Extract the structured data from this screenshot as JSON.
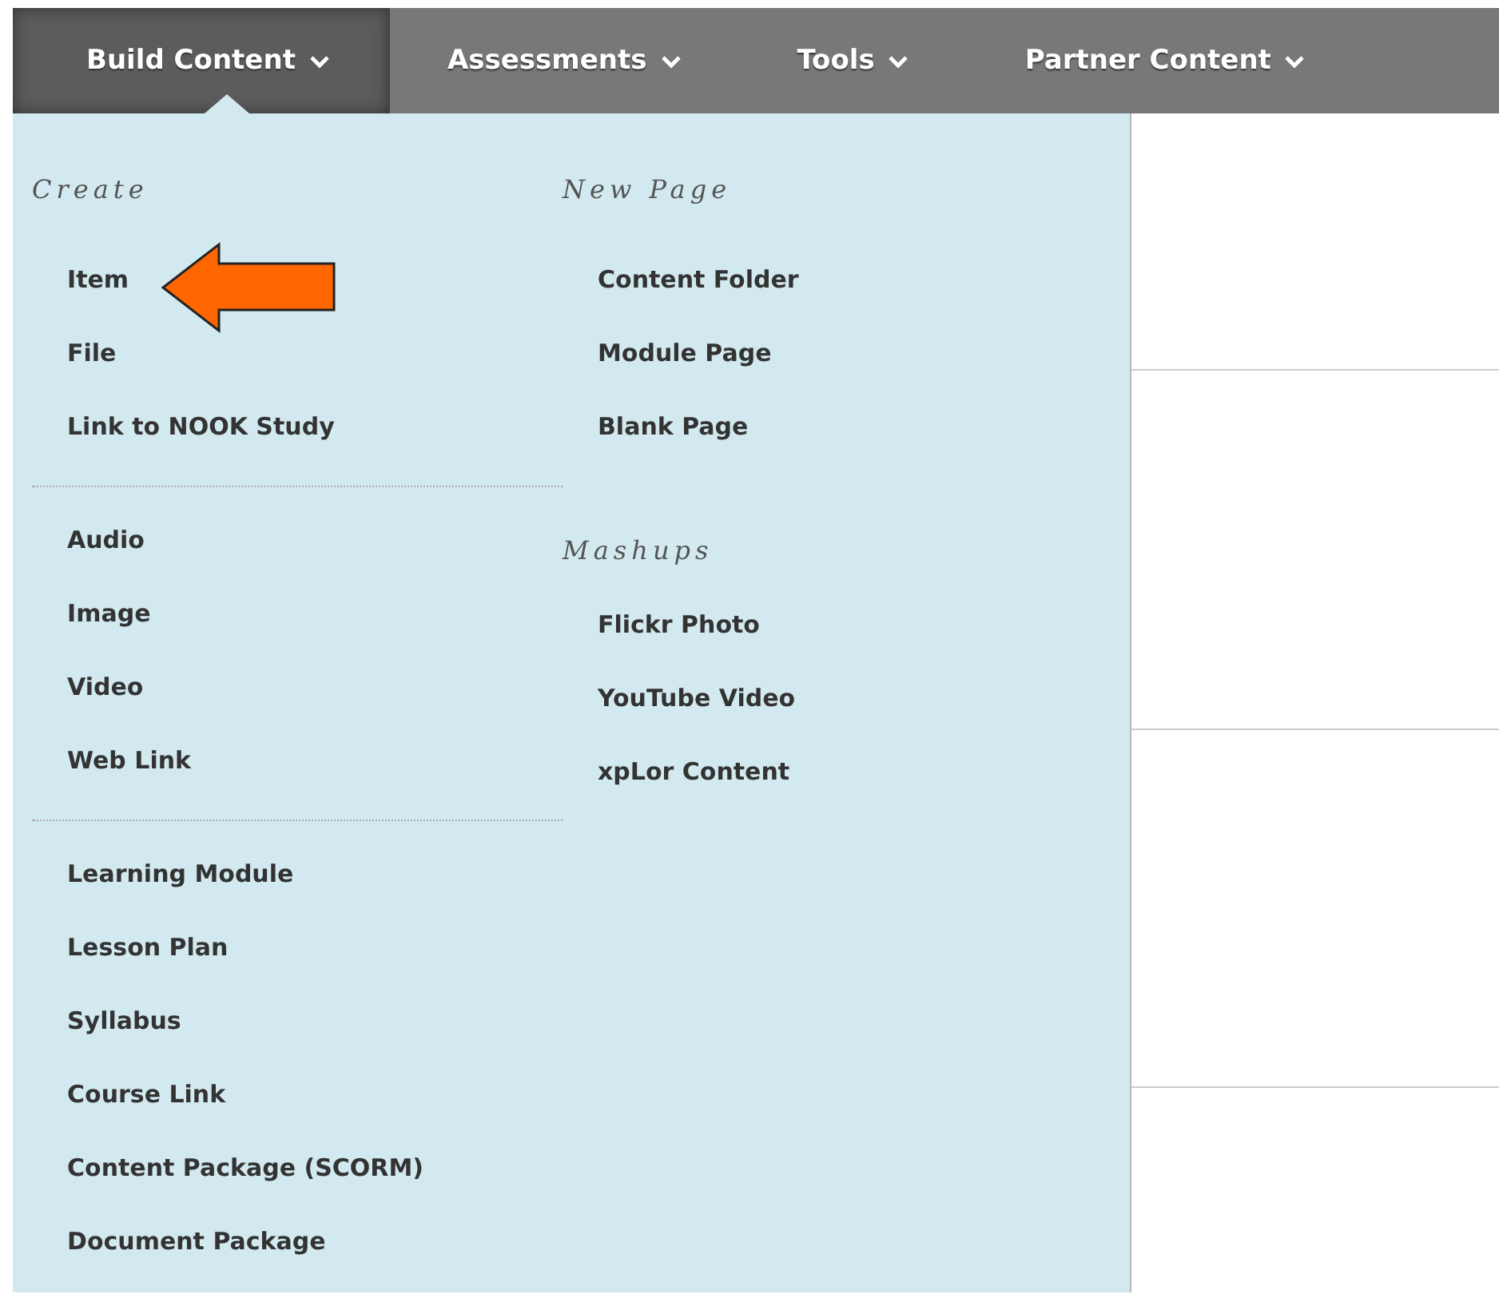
{
  "menubar": {
    "tabs": [
      {
        "label": "Build Content",
        "selected": true
      },
      {
        "label": "Assessments",
        "selected": false
      },
      {
        "label": "Tools",
        "selected": false
      },
      {
        "label": "Partner Content",
        "selected": false
      }
    ]
  },
  "dropdown": {
    "columns": [
      {
        "sections": [
          {
            "heading": "Create",
            "items": [
              "Item",
              "File",
              "Link to NOOK Study"
            ]
          },
          {
            "items": [
              "Audio",
              "Image",
              "Video",
              "Web Link"
            ]
          },
          {
            "items": [
              "Learning Module",
              "Lesson Plan",
              "Syllabus",
              "Course Link",
              "Content Package (SCORM)",
              "Document Package"
            ]
          }
        ]
      },
      {
        "sections": [
          {
            "heading": "New Page",
            "items": [
              "Content Folder",
              "Module Page",
              "Blank Page"
            ]
          },
          {
            "heading": "Mashups",
            "items": [
              "Flickr Photo",
              "YouTube Video",
              "xpLor Content"
            ]
          }
        ]
      }
    ]
  }
}
